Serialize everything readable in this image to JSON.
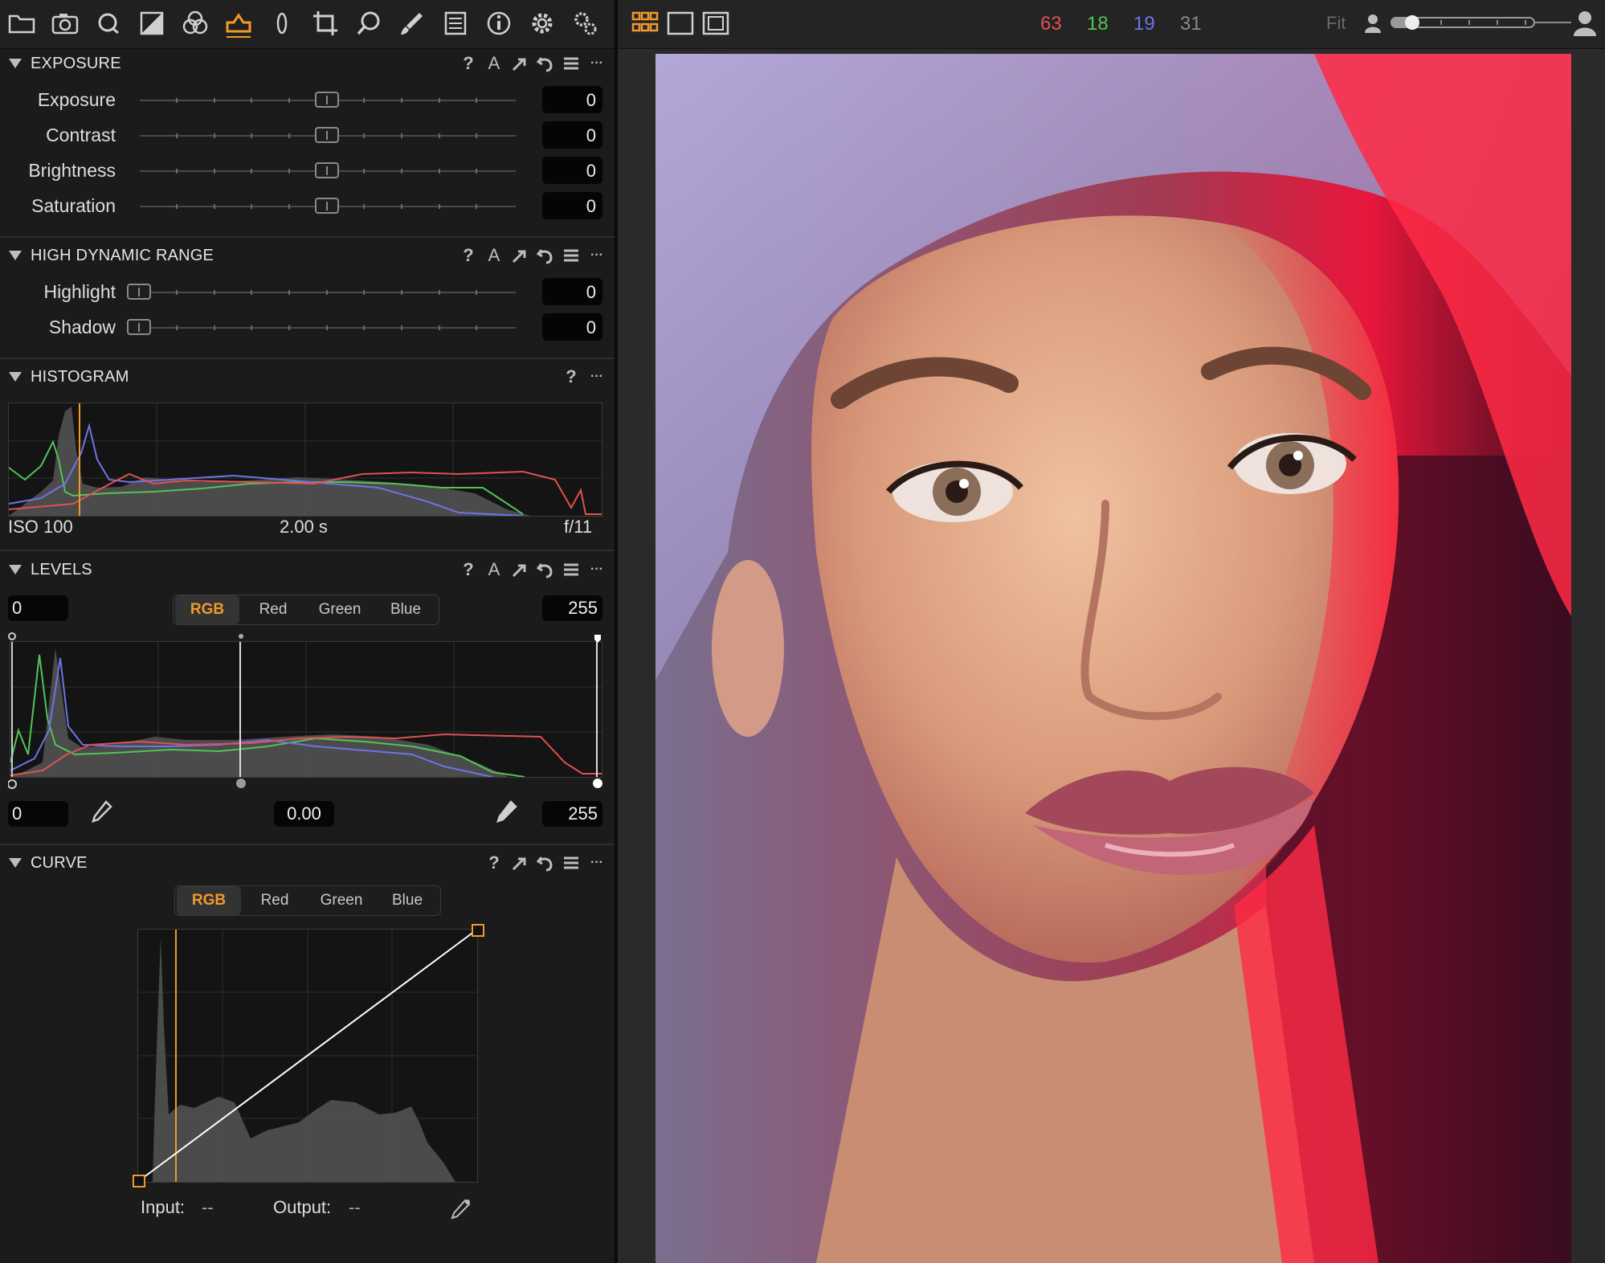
{
  "colors": {
    "accent": "#f09a2c",
    "red": "#e05151",
    "green": "#52c357",
    "blue": "#6f73e8"
  },
  "toolbar": {
    "icons": [
      "folder-icon",
      "camera-icon",
      "search-q-icon",
      "exposure-icon",
      "color-icon",
      "adjust-active-icon",
      "lens-icon",
      "crop-icon",
      "loupe-icon",
      "brush-icon",
      "metadata-icon",
      "info-icon",
      "settings-icon",
      "batch-icon"
    ]
  },
  "viewer_bar": {
    "counts": {
      "red": "63",
      "green": "18",
      "blue": "19",
      "total": "31"
    },
    "fit_label": "Fit",
    "zoom_level": 0.1
  },
  "exposure": {
    "title": "EXPOSURE",
    "rows": [
      {
        "label": "Exposure",
        "value": "0"
      },
      {
        "label": "Contrast",
        "value": "0"
      },
      {
        "label": "Brightness",
        "value": "0"
      },
      {
        "label": "Saturation",
        "value": "0"
      }
    ]
  },
  "hdr": {
    "title": "HIGH DYNAMIC RANGE",
    "rows": [
      {
        "label": "Highlight",
        "value": "0"
      },
      {
        "label": "Shadow",
        "value": "0"
      }
    ]
  },
  "histogram": {
    "title": "HISTOGRAM",
    "iso": "ISO 100",
    "shutter": "2.00 s",
    "aperture": "f/11"
  },
  "levels": {
    "title": "LEVELS",
    "tabs": [
      "RGB",
      "Red",
      "Green",
      "Blue"
    ],
    "active_tab": "RGB",
    "input_low": "0",
    "input_high": "255",
    "output_low": "0",
    "midpoint": "0.00",
    "output_high": "255"
  },
  "curve": {
    "title": "CURVE",
    "tabs": [
      "RGB",
      "Red",
      "Green",
      "Blue"
    ],
    "active_tab": "RGB",
    "input_label": "Input:",
    "input_value": "--",
    "output_label": "Output:",
    "output_value": "--"
  },
  "section_icons": {
    "help": "?",
    "auto": "A",
    "more": "···"
  }
}
